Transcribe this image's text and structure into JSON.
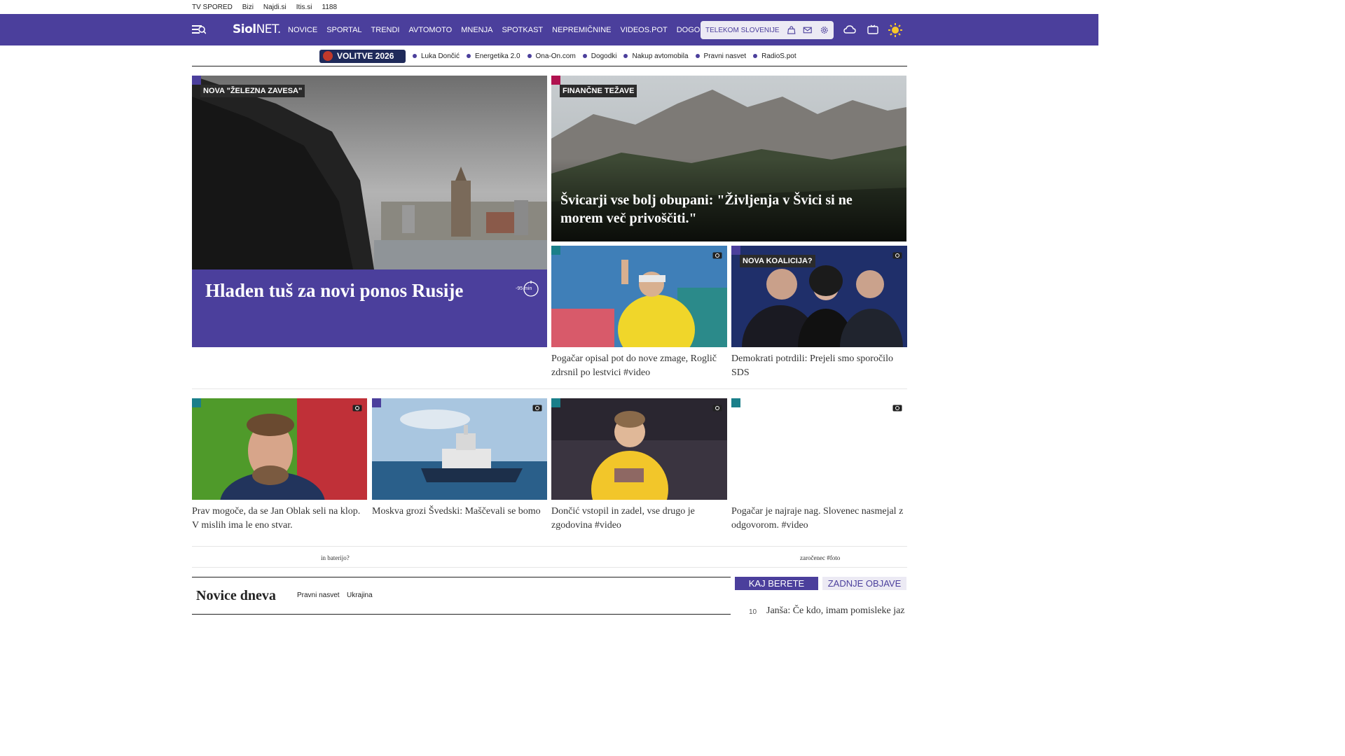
{
  "top_links": [
    "TV SPORED",
    "Bizi",
    "Najdi.si",
    "Itis.si",
    "1188"
  ],
  "header": {
    "logo_main": "Siol",
    "logo_net": "NET.",
    "nav": [
      "NOVICE",
      "SPORTAL",
      "TRENDI",
      "AVTOMOTO",
      "MNENJA",
      "SPOTKAST",
      "NEPREMIČNINE",
      "VIDEOS.POT",
      "DOGODKI"
    ],
    "telekom_label": "TELEKOM SLOVENIJE",
    "brand_color": "#4b3f9c"
  },
  "trending": {
    "badge": "VOLITVE 2026",
    "items": [
      "Luka Dončić",
      "Energetika 2.0",
      "Ona-On.com",
      "Dogodki",
      "Nakup avtomobila",
      "Pravni nasvet",
      "RadioS.pot"
    ]
  },
  "hero": {
    "tag": "NOVA \"ŽELEZNA ZAVESA\"",
    "title": "Hladen tuš za novi ponos Rusije",
    "time": "-95 min"
  },
  "swiss": {
    "tag": "FINANČNE TEŽAVE",
    "title": "Švicarji vse bolj obupani: \"Življenja v Švici si ne morem več privoščiti.\""
  },
  "mid_cards": [
    {
      "tag": "",
      "caption": "Pogačar opisal pot do nove zmage, Roglič zdrsnil po lestvici #video"
    },
    {
      "tag": "NOVA KOALICIJA?",
      "caption": "Demokrati potrdili: Prejeli smo sporočilo SDS"
    }
  ],
  "row_cards": [
    {
      "caption": "Prav mogoče, da se Jan Oblak seli na klop. V mislih ima le eno stvar."
    },
    {
      "caption": "Moskva grozi Švedski: Maščevali se bomo"
    },
    {
      "caption": "Dončić vstopil in zadel, vse drugo je zgodovina #video"
    },
    {
      "caption": "Pogačar je najraje nag. Slovenec nasmejal z odgovorom. #video"
    }
  ],
  "strip": {
    "left": "in baterijo?",
    "right": "zaročenec #foto"
  },
  "novice": {
    "title": "Novice dneva",
    "links": [
      "Pravni nasvet",
      "Ukrajina"
    ]
  },
  "sidebar": {
    "tabs": [
      "KAJ BERETE",
      "ZADNJE OBJAVE"
    ],
    "first_item": {
      "num": "10",
      "text": "Janša: Če kdo, imam pomisleke jaz"
    }
  },
  "colors": {
    "purple": "#4b3f9c",
    "teal": "#1a7f8a",
    "magenta": "#b0124f"
  }
}
